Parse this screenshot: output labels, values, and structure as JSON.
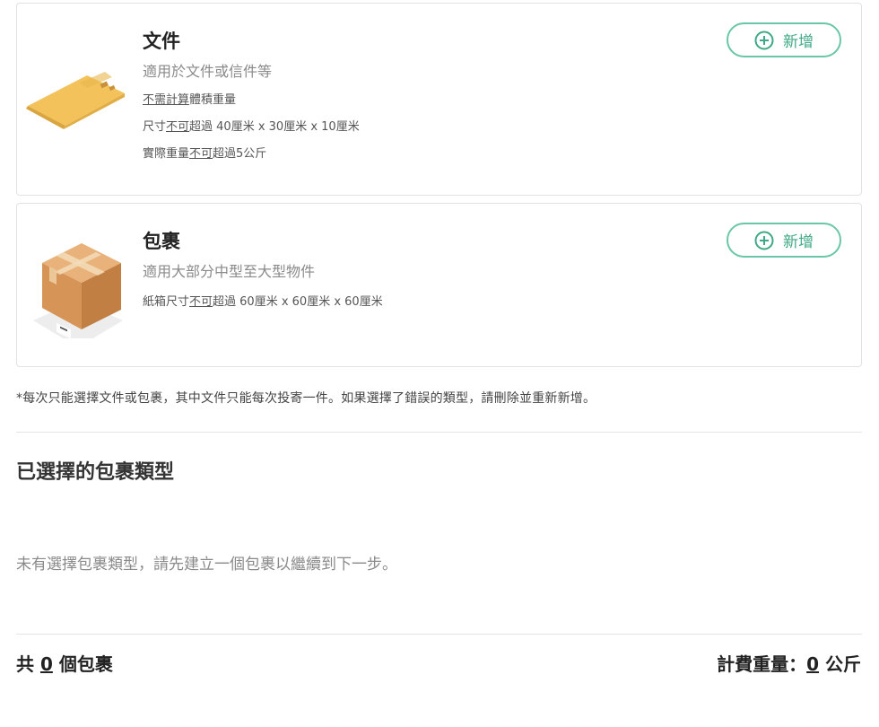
{
  "doc_card": {
    "title": "文件",
    "subtitle": "適用於文件或信件等",
    "line1_a": "不需計算",
    "line1_b": "體積重量",
    "line2_a": "尺寸",
    "line2_b": "不可",
    "line2_c": "超過 40厘米 x 30厘米 x 10厘米",
    "line3_a": "實際重量",
    "line3_b": "不可",
    "line3_c": "超過5公斤",
    "add_label": "新增",
    "image_icon": "envelope-icon"
  },
  "pkg_card": {
    "title": "包裹",
    "subtitle": "適用大部分中型至大型物件",
    "line1_a": "紙箱尺寸",
    "line1_b": "不可",
    "line1_c": "超過 60厘米 x 60厘米 x 60厘米",
    "add_label": "新增",
    "image_icon": "box-icon"
  },
  "note": "*每次只能選擇文件或包裹，其中文件只能每次投寄一件。如果選擇了錯誤的類型，請刪除並重新新增。",
  "selected": {
    "title": "已選擇的包裹類型",
    "empty_message": "未有選擇包裹類型，請先建立一個包裹以繼續到下一步。"
  },
  "summary": {
    "count_prefix": "共 ",
    "count_value": "0",
    "count_suffix": " 個包裹",
    "weight_prefix": "計費重量：",
    "weight_value": "0",
    "weight_suffix": " 公斤"
  },
  "colors": {
    "accent": "#3fa886",
    "accent_border": "#6ac6a8"
  }
}
